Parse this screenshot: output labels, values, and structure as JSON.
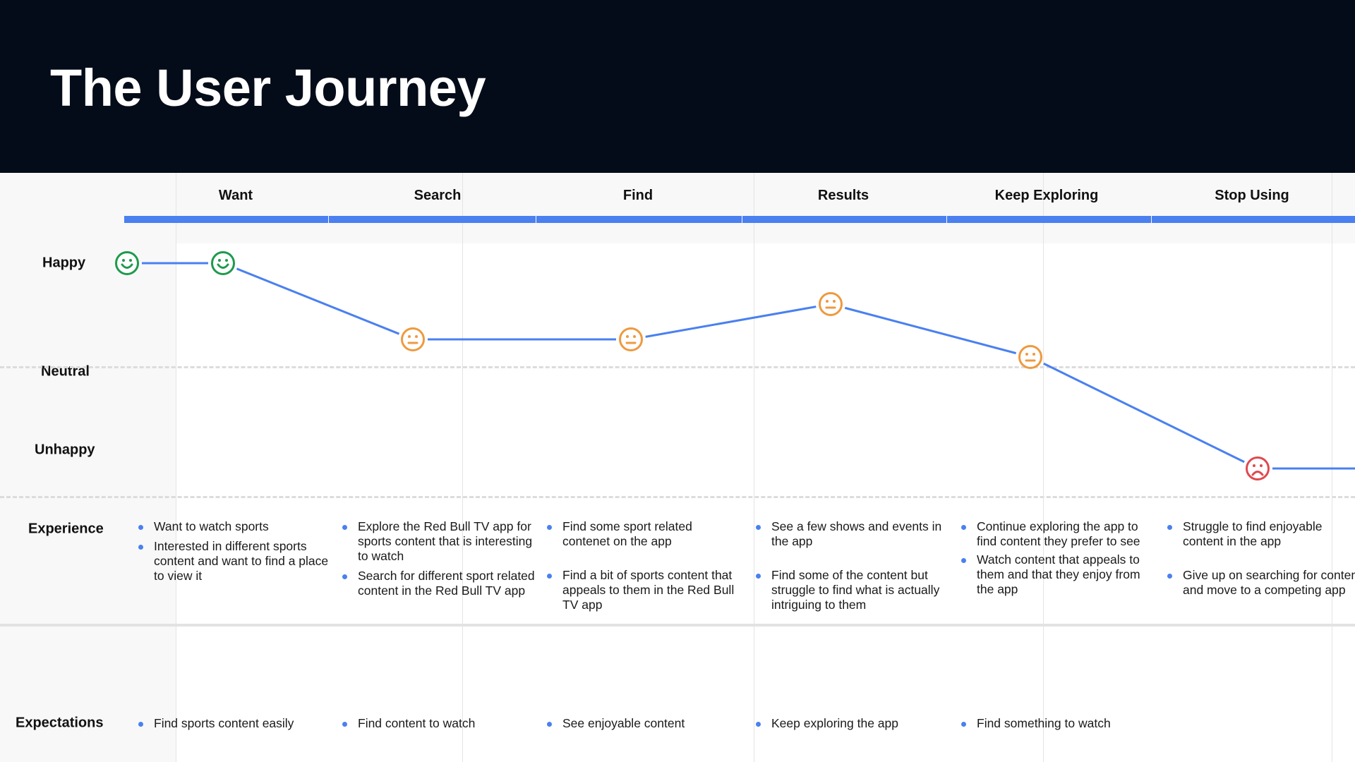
{
  "title": "The User Journey",
  "row_labels": {
    "happy": "Happy",
    "neutral": "Neutral",
    "unhappy": "Unhappy",
    "experience": "Experience",
    "expectations": "Expectations"
  },
  "colors": {
    "accent": "#4a80f0",
    "happy": "#1f9a4d",
    "neutral": "#ee9a3f",
    "sad": "#e0484f",
    "header_bg": "#050c19"
  },
  "stages": [
    {
      "label": "Want",
      "experience": [
        "Want to watch sports",
        "Interested in different sports content and want to find a place to view it"
      ],
      "expectations": [
        "Find sports content easily"
      ]
    },
    {
      "label": "Search",
      "experience": [
        "Explore the Red Bull TV app for sports content that is interesting to watch",
        "Search for different sport related content in the Red Bull TV app"
      ],
      "expectations": [
        "Find content to watch"
      ]
    },
    {
      "label": "Find",
      "experience": [
        "Find some sport related contenet on the app",
        "Find a bit of sports content that appeals to them in the Red Bull TV app"
      ],
      "expectations": [
        "See enjoyable content"
      ]
    },
    {
      "label": "Results",
      "experience": [
        "See a few shows and events in the app",
        "Find some of the content but struggle to find what is actually intriguing to them"
      ],
      "expectations": [
        "Keep exploring the app"
      ]
    },
    {
      "label": "Keep Exploring",
      "experience": [
        "Continue exploring the app to find content they prefer to see",
        "Watch content that appeals to them and that they enjoy from the app"
      ],
      "expectations": [
        "Find something to watch"
      ]
    },
    {
      "label": "Stop Using",
      "experience": [
        "Struggle to find enjoyable content in the app",
        "Give up on searching for content and move to a competing app"
      ],
      "expectations": []
    }
  ],
  "emotion_points": [
    {
      "mood": "happy",
      "icon": "smile-face-icon"
    },
    {
      "mood": "happy",
      "icon": "smile-face-icon"
    },
    {
      "mood": "neutral",
      "icon": "neutral-face-icon"
    },
    {
      "mood": "neutral",
      "icon": "neutral-face-icon"
    },
    {
      "mood": "neutral",
      "icon": "neutral-face-icon"
    },
    {
      "mood": "neutral",
      "icon": "neutral-face-icon"
    },
    {
      "mood": "sad",
      "icon": "sad-face-icon"
    }
  ]
}
